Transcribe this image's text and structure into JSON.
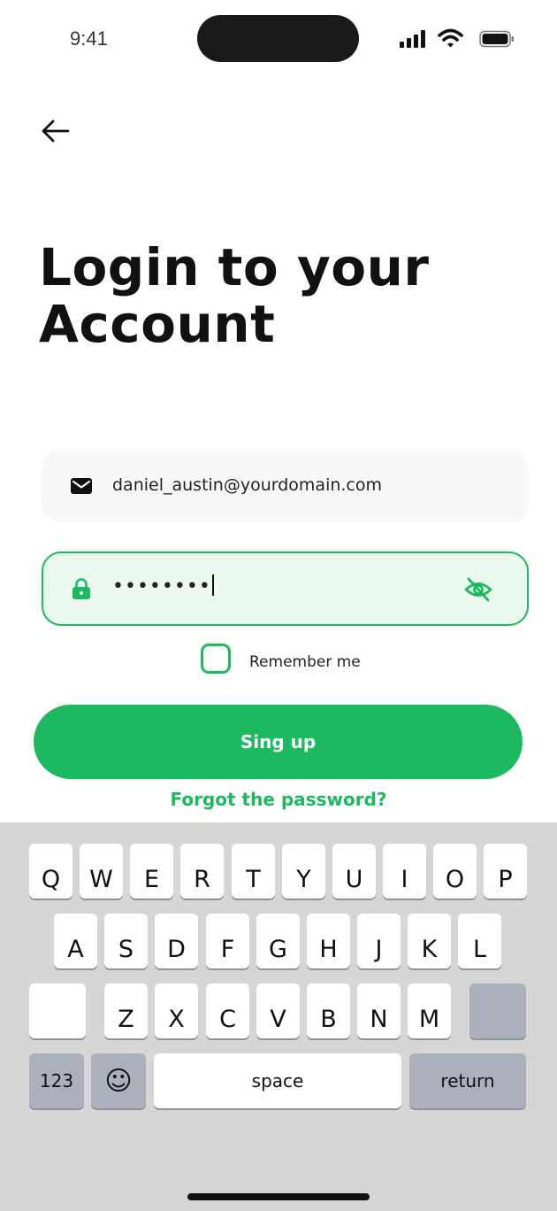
{
  "status_bar": {
    "time": "9:41"
  },
  "page": {
    "title_line1": "Login to your",
    "title_line2": "Account"
  },
  "form": {
    "email_value": "daniel_austin@yourdomain.com",
    "password_value": "••••••••",
    "remember_label": "Remember me",
    "remember_checked": false,
    "submit_label": "Sing up",
    "forgot_label": "Forgot the password?"
  },
  "keyboard": {
    "row1": [
      "Q",
      "W",
      "E",
      "R",
      "T",
      "Y",
      "U",
      "I",
      "O",
      "P"
    ],
    "row2": [
      "A",
      "S",
      "D",
      "F",
      "G",
      "H",
      "J",
      "K",
      "L"
    ],
    "row3": [
      "Z",
      "X",
      "C",
      "V",
      "B",
      "N",
      "M"
    ],
    "numbers_label": "123",
    "space_label": "space",
    "return_label": "return",
    "emoji_label": "☺"
  },
  "colors": {
    "accent": "#1db95e",
    "field_active_bg": "#eaf8ee",
    "keyboard_bg": "#d6d6d6"
  }
}
